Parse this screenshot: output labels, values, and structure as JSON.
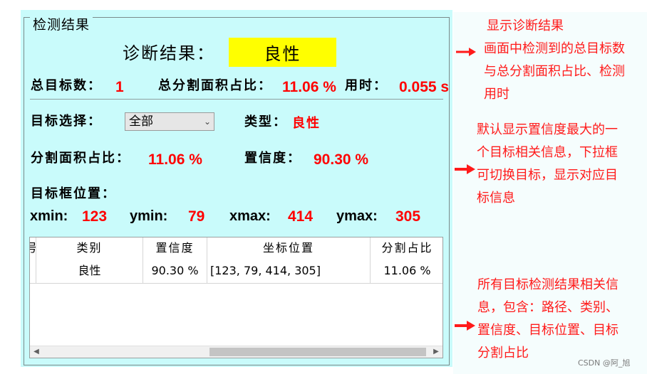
{
  "group_title": "检测结果",
  "diagnosis": {
    "label": "诊断结果：",
    "value": "良性"
  },
  "summary": {
    "total_label": "总目标数：",
    "total_value": "1",
    "area_label": "总分割面积占比：",
    "area_value": "11.06 %",
    "time_label": "用时：",
    "time_value": "0.055 s"
  },
  "target": {
    "select_label": "目标选择：",
    "select_value": "全部",
    "type_label": "类型：",
    "type_value": "良性",
    "area_label": "分割面积占比：",
    "area_value": "11.06 %",
    "conf_label": "置信度：",
    "conf_value": "90.30 %",
    "bbox_label": "目标框位置：",
    "xmin_label": "xmin:",
    "xmin_value": "123",
    "ymin_label": "ymin:",
    "ymin_value": "79",
    "xmax_label": "xmax:",
    "xmax_value": "414",
    "ymax_label": "ymax:",
    "ymax_value": "305"
  },
  "table": {
    "headers": [
      "号",
      "类别",
      "置信度",
      "坐标位置",
      "分割占比"
    ],
    "rows": [
      [
        "",
        "良性",
        "90.30 %",
        "[123, 79, 414, 305]",
        "11.06 %"
      ]
    ]
  },
  "notes": {
    "n1_title": "显示诊断结果",
    "n2_line1": "画面中检测到的总目标数",
    "n2_line2": "与总分割面积占比、检测",
    "n2_line3": "用时",
    "n3_line1": "默认显示置信度最大的一",
    "n3_line2": "个目标相关信息，下拉框",
    "n3_line3": "可切换目标，显示对应目",
    "n3_line4": "标信息",
    "n4_line1": "所有目标检测结果相关信",
    "n4_line2": "息，包含：路径、类别、",
    "n4_line3": "置信度、目标位置、目标",
    "n4_line4": "分割占比"
  },
  "watermark": "CSDN @阿_旭",
  "colors": {
    "panel": "#c9fbfb",
    "highlight": "#ffff00",
    "value_red": "#ff0000",
    "note_red": "#ff1a1a"
  },
  "icons": {
    "dropdown": "chevron-down-icon",
    "scroll_left": "arrow-left-icon",
    "scroll_right": "arrow-right-icon"
  }
}
